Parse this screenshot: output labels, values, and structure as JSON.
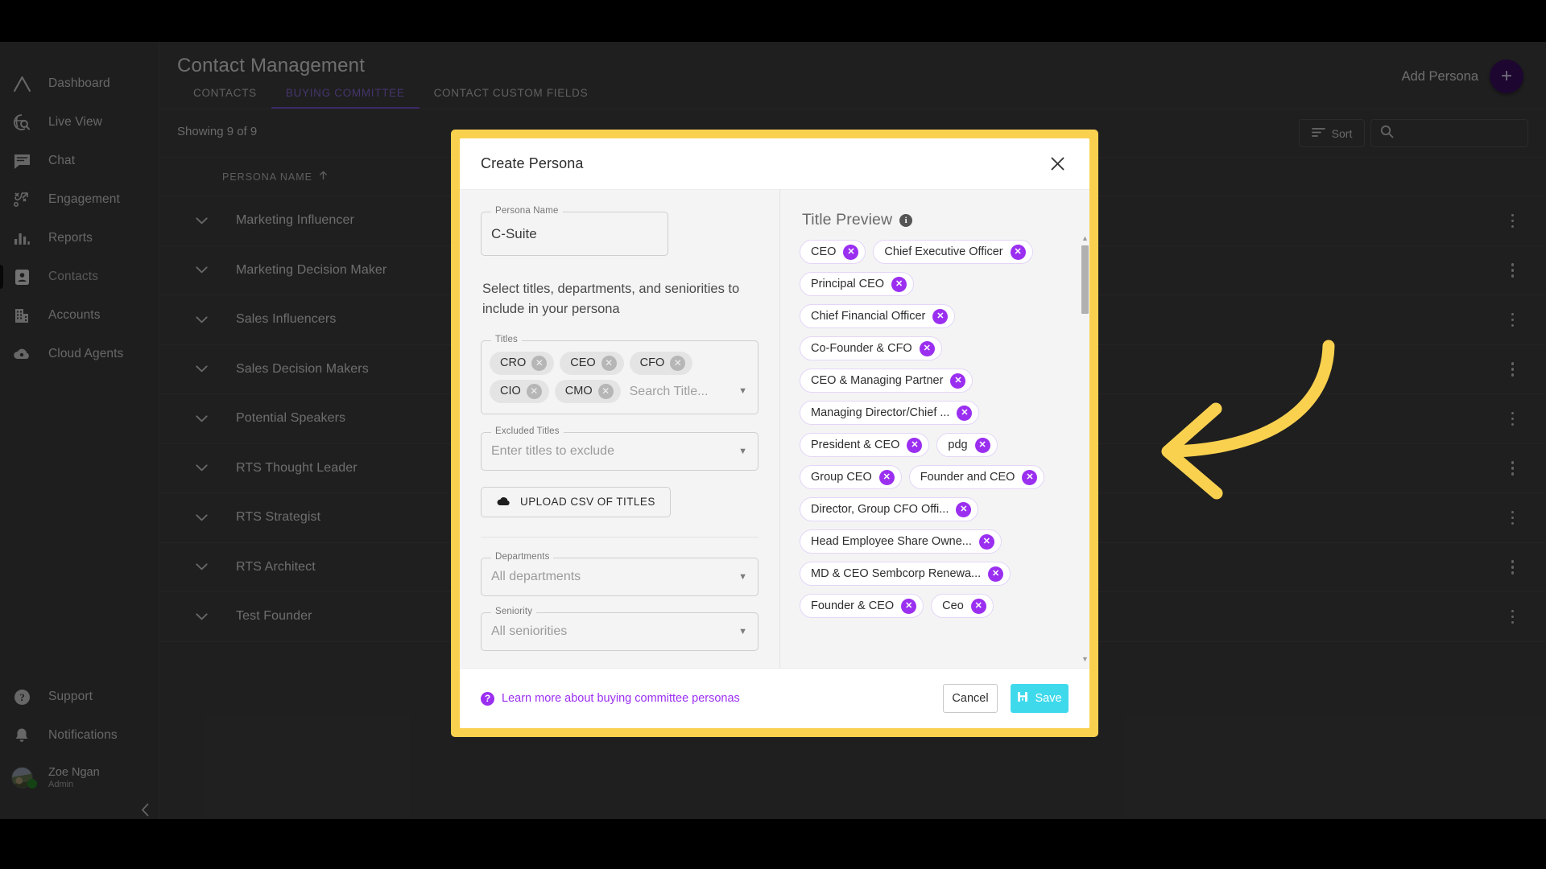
{
  "app": {
    "sidebar": {
      "top_items": [
        {
          "label": "Dashboard",
          "icon": "chevron-logo-icon",
          "active": false
        },
        {
          "label": "Live View",
          "icon": "globe-search-icon",
          "active": false
        },
        {
          "label": "Chat",
          "icon": "chat-bubble-icon",
          "active": false
        },
        {
          "label": "Engagement",
          "icon": "strategy-icon",
          "active": false
        },
        {
          "label": "Reports",
          "icon": "bar-chart-icon",
          "active": false
        },
        {
          "label": "Contacts",
          "icon": "contact-card-icon",
          "active": true
        },
        {
          "label": "Accounts",
          "icon": "building-icon",
          "active": false
        },
        {
          "label": "Cloud Agents",
          "icon": "cloud-agent-icon",
          "active": false
        }
      ],
      "bottom_items": [
        {
          "label": "Support",
          "icon": "question-circle-icon"
        },
        {
          "label": "Notifications",
          "icon": "bell-icon"
        }
      ],
      "user": {
        "name": "Zoe Ngan",
        "role": "Admin",
        "presence": "online"
      },
      "collapse_icon": "chevron-left-icon"
    },
    "header": {
      "title": "Contact Management",
      "tabs": [
        {
          "label": "CONTACTS",
          "selected": false
        },
        {
          "label": "BUYING COMMITTEE",
          "selected": true
        },
        {
          "label": "CONTACT CUSTOM FIELDS",
          "selected": false
        }
      ],
      "add_persona_label": "Add Persona",
      "add_persona_icon": "plus-icon"
    },
    "toolbar": {
      "showing": "Showing 9 of 9",
      "sort_label": "Sort",
      "sort_icon": "sort-icon",
      "search_icon": "search-icon",
      "search_value": "",
      "search_placeholder": ""
    },
    "table": {
      "column_header": "PERSONA NAME",
      "sort_direction_icon": "arrow-up-icon",
      "rows": [
        "Marketing Influencer",
        "Marketing Decision Maker",
        "Sales Influencers",
        "Sales Decision Makers",
        "Potential Speakers",
        "RTS Thought Leader",
        "RTS Strategist",
        "RTS Architect",
        "Test Founder"
      ]
    }
  },
  "modal": {
    "title": "Create Persona",
    "close_icon": "close-icon",
    "persona_name": {
      "legend": "Persona Name",
      "value": "C-Suite"
    },
    "helper_text": "Select titles, departments, and seniorities to include in your persona",
    "titles": {
      "legend": "Titles",
      "chips": [
        "CRO",
        "CEO",
        "CFO",
        "CIO",
        "CMO"
      ],
      "placeholder": "Search Title...",
      "caret_icon": "chevron-down-icon"
    },
    "excluded_titles": {
      "legend": "Excluded Titles",
      "placeholder": "Enter titles to exclude",
      "value": "",
      "caret_icon": "chevron-down-icon"
    },
    "upload_button": {
      "label": "UPLOAD CSV OF TITLES",
      "icon": "cloud-upload-icon"
    },
    "departments": {
      "legend": "Departments",
      "placeholder": "All departments",
      "value": "",
      "caret_icon": "chevron-down-icon"
    },
    "seniority": {
      "legend": "Seniority",
      "placeholder": "All seniorities",
      "value": "",
      "caret_icon": "chevron-down-icon"
    },
    "title_preview": {
      "heading": "Title Preview",
      "info_icon": "info-icon",
      "chips": [
        "CEO",
        "Chief Executive Officer",
        "Principal CEO",
        "Chief Financial Officer",
        "Co-Founder & CFO",
        "CEO & Managing Partner",
        "Managing Director/Chief ...",
        "President & CEO",
        "pdg",
        "Group CEO",
        "Founder and CEO",
        "Director, Group CFO Offi...",
        "Head Employee Share Owne...",
        "MD & CEO Sembcorp Renewa...",
        "Founder & CEO",
        "Ceo"
      ],
      "scrollbar": {
        "up_icon": "caret-up-icon",
        "down_icon": "caret-down-icon"
      }
    },
    "footer": {
      "learn_icon": "question-circle-icon",
      "learn_label": "Learn more about buying committee personas",
      "cancel_label": "Cancel",
      "save_label": "Save",
      "save_icon": "save-disk-icon"
    }
  },
  "annotation": {
    "type": "curved-arrow",
    "color": "#FAD14F",
    "points_to": "create-persona-modal"
  },
  "colors": {
    "highlight_border": "#FAD14F",
    "accent_purple": "#9b2ff0",
    "tab_purple": "#7b57d6",
    "fab_purple": "#3d1066",
    "save_cyan": "#3fd9ec"
  }
}
